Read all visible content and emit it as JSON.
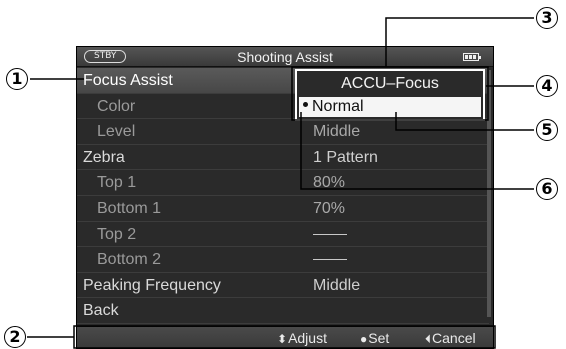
{
  "screen": {
    "status_badge": "STBY",
    "title": "Shooting Assist",
    "battery_icon": "battery-icon"
  },
  "menu": {
    "rows": [
      {
        "label": "Focus Assist",
        "value": "",
        "level": 0
      },
      {
        "label": "Color",
        "value": "",
        "level": 1
      },
      {
        "label": "Level",
        "value": "Middle",
        "level": 1
      },
      {
        "label": "Zebra",
        "value": "1 Pattern",
        "level": 0
      },
      {
        "label": "Top 1",
        "value": "80%",
        "level": 1
      },
      {
        "label": "Bottom 1",
        "value": "70%",
        "level": 1
      },
      {
        "label": "Top 2",
        "value": "",
        "level": 1
      },
      {
        "label": "Bottom 2",
        "value": "",
        "level": 1
      },
      {
        "label": "Peaking Frequency",
        "value": "Middle",
        "level": 0
      },
      {
        "label": "Back",
        "value": "",
        "level": 0
      }
    ]
  },
  "popup": {
    "title": "ACCU–Focus",
    "selected_option": "Normal"
  },
  "hints": {
    "adjust": "Adjust",
    "set": "Set",
    "cancel": "Cancel",
    "adjust_glyph": "⬍",
    "set_glyph": "●",
    "cancel_glyph": "⏴"
  },
  "callouts": {
    "c1": "1",
    "c2": "2",
    "c3": "3",
    "c4": "4",
    "c5": "5",
    "c6": "6"
  }
}
